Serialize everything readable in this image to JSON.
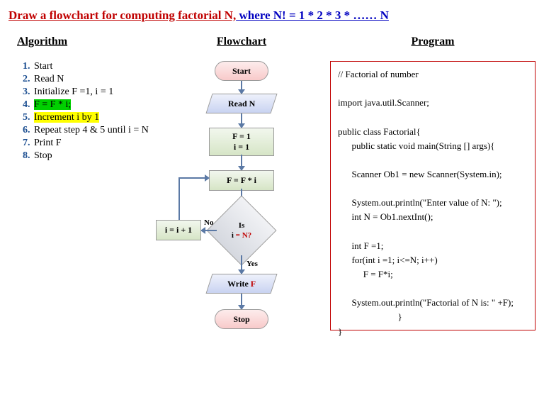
{
  "title": {
    "part1": "Draw a flowchart for computing factorial N,",
    "part2": " where N! = 1 * 2 * 3 * …… N"
  },
  "headings": {
    "algorithm": "Algorithm",
    "flowchart": "Flowchart",
    "program": "Program"
  },
  "algorithm": {
    "s1": "Start",
    "s2": "Read N",
    "s3": "Initialize F =1, i = 1",
    "s4": "F = F * i;",
    "s5": "Increment i by 1",
    "s6a": "Repeat step 4 & 5 until i ",
    "s6b": "= N",
    "s7a": "Print ",
    "s7b": "F",
    "s8": "Stop"
  },
  "flowchart": {
    "start": "Start",
    "read": "Read  N",
    "init1": "F = 1",
    "init2": "i = 1",
    "mult": "F = F * i",
    "dec1": "Is",
    "dec2a": "i ",
    "dec2b": "= N?",
    "inc": "i = i + 1",
    "no": "No",
    "yes": "Yes",
    "write1": "Write ",
    "write2": "F",
    "stop": "Stop"
  },
  "program": {
    "l1": "// Factorial of number",
    "l2": "",
    "l3": "import java.util.Scanner;",
    "l4": "",
    "l5": "public class Factorial{",
    "l6": "      public static void main(String [] args){",
    "l7": "",
    "l8": "      Scanner Ob1 = new Scanner(System.in);",
    "l9": "",
    "l10": "      System.out.println(\"Enter value of N: \");",
    "l11": "      int N = Ob1.nextInt();",
    "l12": "",
    "l13": "      int F =1;",
    "l14": "      for(int i =1; i<=N; i++)",
    "l15": "           F = F*i;",
    "l16": "",
    "l17": "      System.out.println(\"Factorial of N is: \" +F);",
    "l18": "                          }",
    "l19": "}"
  }
}
